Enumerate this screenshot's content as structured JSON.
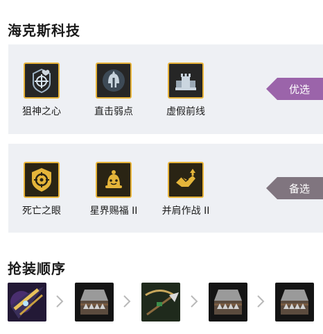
{
  "sections": {
    "hextech_title": "海克斯科技",
    "build_title": "抢装顺序"
  },
  "preferred": {
    "tag": "优选",
    "tag_color": "#9b64aa",
    "augments": [
      {
        "label": "狙神之心",
        "icon": "crosshair-heart-icon"
      },
      {
        "label": "直击弱点",
        "icon": "spartan-helmet-icon"
      },
      {
        "label": "虚假前线",
        "icon": "castle-rook-icon"
      }
    ]
  },
  "alternate": {
    "tag": "备选",
    "tag_color": "#80757f",
    "augments": [
      {
        "label": "死亡之眼",
        "icon": "target-shield-icon"
      },
      {
        "label": "星界赐福 II",
        "icon": "bell-blessing-icon"
      },
      {
        "label": "并肩作战 II",
        "icon": "handshake-arrow-icon"
      }
    ]
  },
  "build_order": [
    {
      "item": "star-blade-icon"
    },
    {
      "item": "spiked-armor-icon"
    },
    {
      "item": "spear-bow-icon"
    },
    {
      "item": "spiked-armor-icon"
    },
    {
      "item": "spiked-armor-icon"
    }
  ]
}
